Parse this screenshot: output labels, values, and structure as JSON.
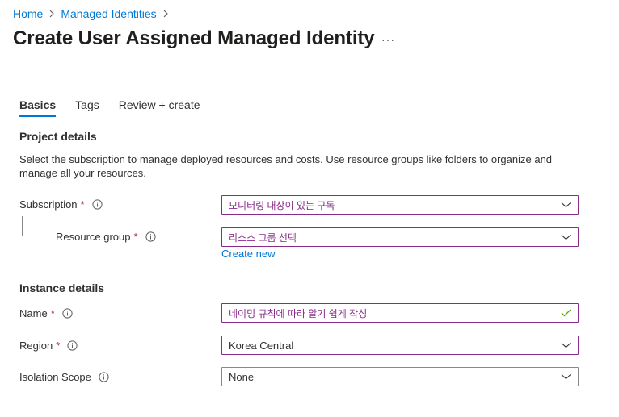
{
  "breadcrumb": {
    "items": [
      "Home",
      "Managed Identities"
    ]
  },
  "page": {
    "title": "Create User Assigned Managed Identity",
    "more_label": "···"
  },
  "tabs": [
    {
      "label": "Basics",
      "active": true
    },
    {
      "label": "Tags",
      "active": false
    },
    {
      "label": "Review + create",
      "active": false
    }
  ],
  "project": {
    "heading": "Project details",
    "description": "Select the subscription to manage deployed resources and costs. Use resource groups like folders to organize and manage all your resources.",
    "subscription": {
      "label": "Subscription",
      "required": "*",
      "value": "모니터링 대상이 있는 구독"
    },
    "resource_group": {
      "label": "Resource group",
      "required": "*",
      "value": "리소스 그룹 선택",
      "create_new": "Create new"
    }
  },
  "instance": {
    "heading": "Instance details",
    "name": {
      "label": "Name",
      "required": "*",
      "value": "네이밍 규칙에 따라 알기 쉽게 작성"
    },
    "region": {
      "label": "Region",
      "required": "*",
      "value": "Korea Central"
    },
    "isolation": {
      "label": "Isolation Scope",
      "value": "None"
    }
  },
  "colors": {
    "accent": "#0078d4",
    "annotation": "#8a2a8a",
    "required": "#a4262c",
    "valid": "#57a300"
  },
  "icons": [
    "chevron-right-icon",
    "info-icon",
    "chevron-down-icon",
    "checkmark-icon"
  ]
}
